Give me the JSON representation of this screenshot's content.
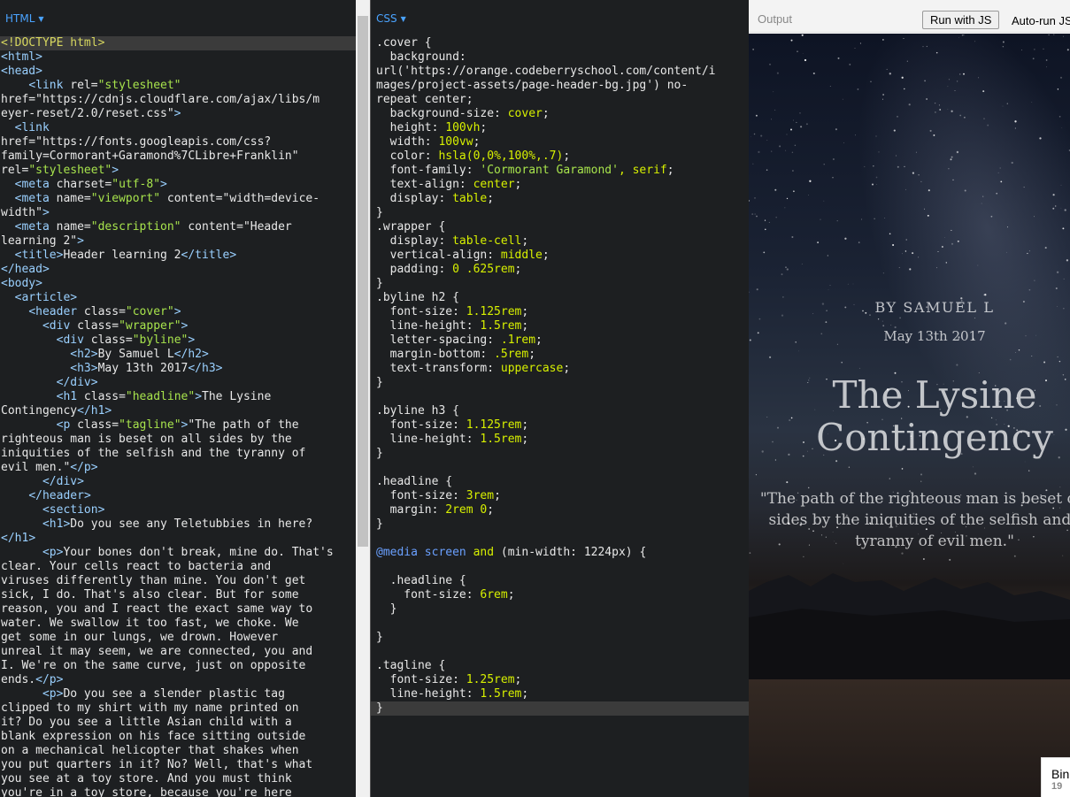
{
  "html_panel": {
    "label": "HTML",
    "lines": [
      "<!DOCTYPE html>",
      "<html>",
      "<head>",
      "    <link rel=\"stylesheet\"",
      "href=\"https://cdnjs.cloudflare.com/ajax/libs/m",
      "eyer-reset/2.0/reset.css\">",
      "  <link",
      "href=\"https://fonts.googleapis.com/css?",
      "family=Cormorant+Garamond%7CLibre+Franklin\"",
      "rel=\"stylesheet\">",
      "  <meta charset=\"utf-8\">",
      "  <meta name=\"viewport\" content=\"width=device-",
      "width\">",
      "  <meta name=\"description\" content=\"Header",
      "learning 2\">",
      "  <title>Header learning 2</title>",
      "</head>",
      "<body>",
      "  <article>",
      "    <header class=\"cover\">",
      "      <div class=\"wrapper\">",
      "        <div class=\"byline\">",
      "          <h2>By Samuel L</h2>",
      "          <h3>May 13th 2017</h3>",
      "        </div>",
      "        <h1 class=\"headline\">The Lysine",
      "Contingency</h1>",
      "        <p class=\"tagline\">\"The path of the",
      "righteous man is beset on all sides by the",
      "iniquities of the selfish and the tyranny of",
      "evil men.\"</p>",
      "      </div>",
      "    </header>",
      "      <section>",
      "      <h1>Do you see any Teletubbies in here?",
      "</h1>",
      "      <p>Your bones don't break, mine do. That's",
      "clear. Your cells react to bacteria and",
      "viruses differently than mine. You don't get",
      "sick, I do. That's also clear. But for some",
      "reason, you and I react the exact same way to",
      "water. We swallow it too fast, we choke. We",
      "get some in our lungs, we drown. However",
      "unreal it may seem, we are connected, you and",
      "I. We're on the same curve, just on opposite",
      "ends.</p>",
      "      <p>Do you see a slender plastic tag",
      "clipped to my shirt with my name printed on",
      "it? Do you see a little Asian child with a",
      "blank expression on his face sitting outside",
      "on a mechanical helicopter that shakes when",
      "you put quarters in it? No? Well, that's what",
      "you see at a toy store. And you must think",
      "you're in a toy store, because you're here"
    ]
  },
  "css_panel": {
    "label": "CSS",
    "lines": [
      ".cover {",
      "  background:",
      "url('https://orange.codeberryschool.com/content/i",
      "mages/project-assets/page-header-bg.jpg') no-",
      "repeat center;",
      "  background-size: cover;",
      "  height: 100vh;",
      "  width: 100vw;",
      "  color: hsla(0,0%,100%,.7);",
      "  font-family: 'Cormorant Garamond', serif;",
      "  text-align: center;",
      "  display: table;",
      "}",
      ".wrapper {",
      "  display: table-cell;",
      "  vertical-align: middle;",
      "  padding: 0 .625rem;",
      "}",
      ".byline h2 {",
      "  font-size: 1.125rem;",
      "  line-height: 1.5rem;",
      "  letter-spacing: .1rem;",
      "  margin-bottom: .5rem;",
      "  text-transform: uppercase;",
      "}",
      "",
      ".byline h3 {",
      "  font-size: 1.125rem;",
      "  line-height: 1.5rem;",
      "}",
      "",
      ".headline {",
      "  font-size: 3rem;",
      "  margin: 2rem 0;",
      "}",
      "",
      "@media screen and (min-width: 1224px) {",
      "",
      "  .headline {",
      "    font-size: 6rem;",
      "  }",
      "",
      "}",
      "",
      ".tagline {",
      "  font-size: 1.25rem;",
      "  line-height: 1.5rem;",
      "}"
    ]
  },
  "output_panel": {
    "label": "Output",
    "run_button": "Run with JS",
    "autorun_label": "Auto-run JS",
    "byline_name": "By Samuel L",
    "byline_date": "May 13th 2017",
    "headline": "The Lysine Contingency",
    "tagline": "\"The path of the righteous man is beset on all sides by the iniquities of the selfish and the tyranny of evil men.\"",
    "badge_title": "Bin",
    "badge_count": "19"
  }
}
